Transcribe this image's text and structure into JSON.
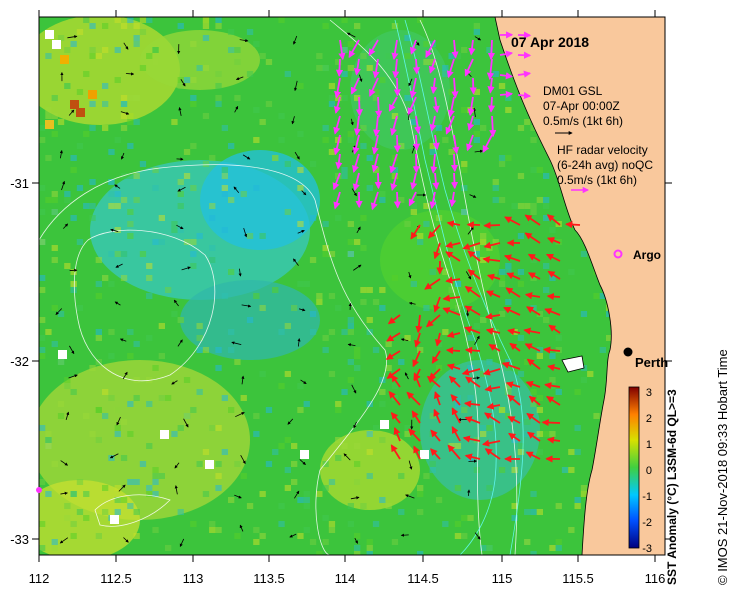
{
  "date_label": "07 Apr 2018",
  "legend_block_1": {
    "line1": "DM01 GSL",
    "line2": "07-Apr 00:00Z",
    "line3": "0.5m/s (1kt 6h)"
  },
  "legend_block_2": {
    "line1": "HF radar velocity",
    "line2": "(6-24h avg) noQC",
    "line3": "0.5m/s (1kt 6h)"
  },
  "places": {
    "argo": "Argo",
    "perth": "Perth"
  },
  "colorbar": {
    "title": "SST Anomaly (°C) L3SM-6d QL>=3",
    "ticks": [
      "3",
      "2",
      "1",
      "0",
      "-1",
      "-2",
      "-3"
    ]
  },
  "credit": "© IMOS 21-Nov-2018 09:33 Hobart Time",
  "x_ticks": [
    "112",
    "112.5",
    "113",
    "113.5",
    "114",
    "114.5",
    "115",
    "115.5",
    "116"
  ],
  "y_ticks": [
    "-31",
    "-32",
    "-33"
  ],
  "colors": {
    "ocean_green": "#3cc43c",
    "land": "#f9c89c",
    "glider_vectors": "#ff33ff",
    "radar_vectors": "#ff1a1a",
    "argo_marker": "#ff33ff"
  }
}
